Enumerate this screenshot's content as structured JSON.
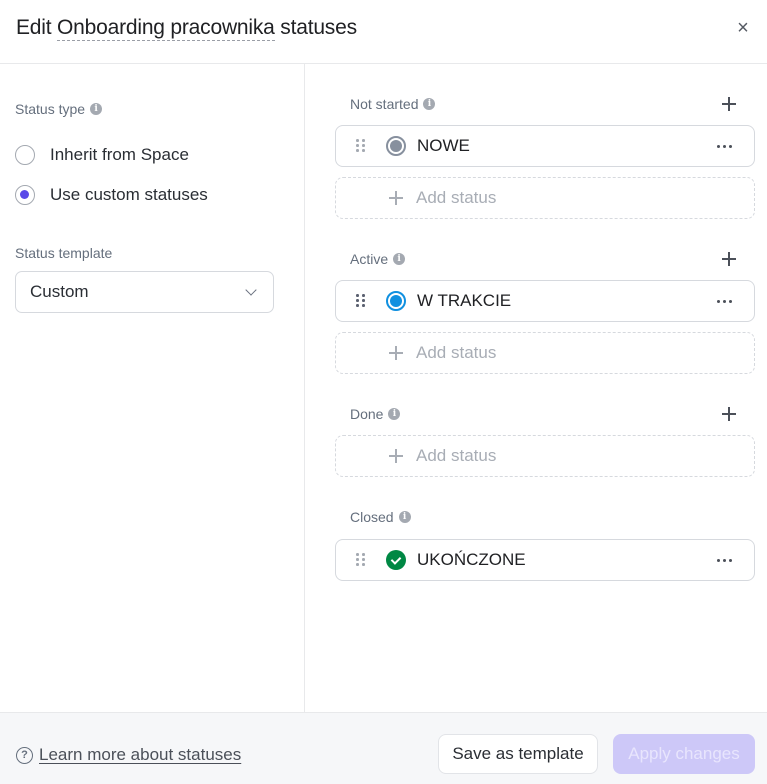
{
  "header": {
    "title_prefix": "Edit",
    "list_name": "Onboarding pracownika",
    "title_suffix": "statuses",
    "close_icon": "×"
  },
  "left_panel": {
    "status_type_label": "Status type",
    "options": [
      {
        "label": "Inherit from Space",
        "checked": false
      },
      {
        "label": "Use custom statuses",
        "checked": true
      }
    ],
    "status_template_label": "Status template",
    "status_template_value": "Custom"
  },
  "groups": [
    {
      "label": "Not started",
      "statuses": [
        {
          "name": "NOWE",
          "color": "#87909e",
          "icon": "ring"
        }
      ],
      "add_label": "Add status"
    },
    {
      "label": "Active",
      "statuses": [
        {
          "name": "W TRAKCIE",
          "color": "#1090e0",
          "icon": "ring"
        }
      ],
      "add_label": "Add status"
    },
    {
      "label": "Done",
      "statuses": [],
      "add_label": "Add status"
    },
    {
      "label": "Closed",
      "statuses": [
        {
          "name": "UKOŃCZONE",
          "color": "#008844",
          "icon": "check"
        }
      ]
    }
  ],
  "footer": {
    "learn_more": "Learn more about statuses",
    "save_template": "Save as template",
    "apply_changes": "Apply changes"
  },
  "colors": {
    "accent": "#5b4ae8",
    "apply_disabled_bg": "#cdc8f8"
  }
}
